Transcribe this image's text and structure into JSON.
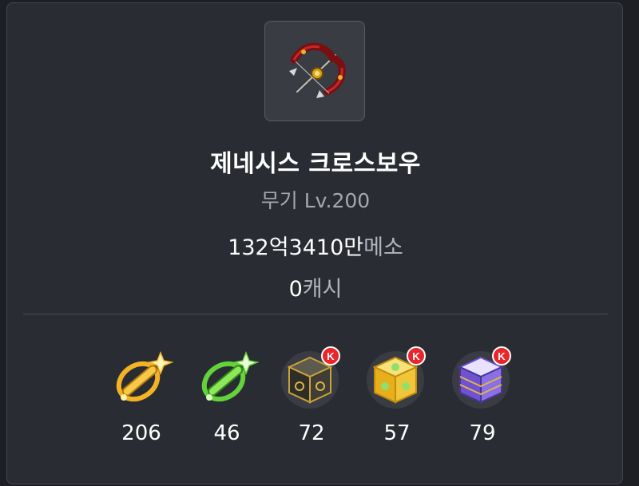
{
  "item": {
    "icon": "genesis-crossbow-icon",
    "name": "제네시스 크로스보우",
    "category": "무기 Lv.200",
    "meso_value": "132억3410만",
    "meso_unit": "메소",
    "cash_value": "0",
    "cash_unit": "캐시"
  },
  "inventory": [
    {
      "icon": "gold-star-scroll-icon",
      "count": "206"
    },
    {
      "icon": "green-star-scroll-icon",
      "count": "46"
    },
    {
      "icon": "black-cube-k-icon",
      "count": "72"
    },
    {
      "icon": "additional-cube-k-icon",
      "count": "57"
    },
    {
      "icon": "violet-cube-k-icon",
      "count": "79"
    }
  ],
  "colors": {
    "background": "#1e1f24",
    "card": "#2a2c33",
    "border": "#43464f",
    "muted_text": "#a6a8ae"
  }
}
